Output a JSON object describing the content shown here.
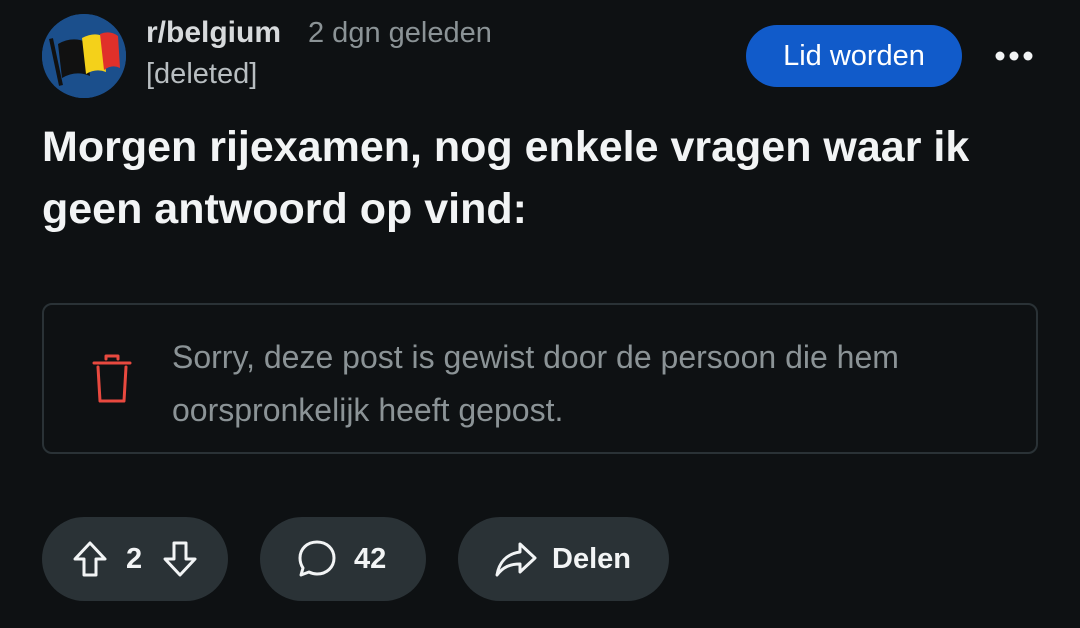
{
  "post": {
    "subreddit": "r/belgium",
    "time_ago": "2 dgn geleden",
    "author": "[deleted]",
    "title": "Morgen rijexamen, nog enkele vragen waar ik geen antwoord op vind:",
    "deleted_message": "Sorry, deze post is gewist door de persoon die hem oorspronkelijk heeft gepost."
  },
  "actions": {
    "join_label": "Lid worden",
    "vote_count": "2",
    "comment_count": "42",
    "share_label": "Delen"
  },
  "icons": {
    "avatar": "belgian-flag",
    "more": "more-horizontal-icon",
    "trash": "trash-icon",
    "upvote": "upvote-arrow-icon",
    "downvote": "downvote-arrow-icon",
    "comment": "comment-bubble-icon",
    "share": "share-arrow-icon"
  },
  "colors": {
    "background": "#0e1113",
    "join_button": "#115bca",
    "trash_icon": "#e8493f",
    "pill_background": "#2a3236"
  }
}
